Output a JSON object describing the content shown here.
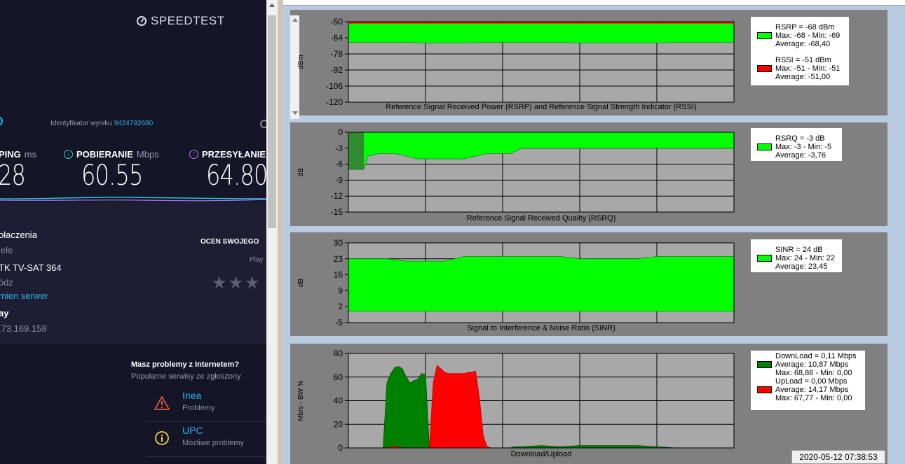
{
  "speedtest": {
    "logo": "SPEEDTEST",
    "result_id_label": "Identyfikator wyniku",
    "result_id": "9424792680",
    "ping": {
      "label": "PING",
      "unit": "ms",
      "value": "28"
    },
    "download": {
      "label": "POBIERANIE",
      "unit": "Mbps",
      "value": "60.55"
    },
    "upload": {
      "label": "PRZESYŁANIE",
      "value": "64.80"
    },
    "connection_label": "ołaczenia",
    "connection_type": "iele",
    "provider": "TK TV-SAT 364",
    "server_city": "ódz",
    "change_server": "mien serwer",
    "ip_label": "ay",
    "ip": ".73.169.158",
    "rate_label": "OCEN SWOJEGO",
    "rate_sub": "Play",
    "problems_title": "Masz problemy z Internetem?",
    "problems_sub": "Popularne serwisy ze zgłoszony",
    "isps": [
      {
        "name": "Inea",
        "status": "Problemy",
        "icon": "warning-triangle-icon",
        "color": "#e8553e"
      },
      {
        "name": "UPC",
        "status": "Mozliwe problemy",
        "icon": "info-circle-icon",
        "color": "#f2d43a"
      }
    ]
  },
  "monitor": {
    "timestamp": "2020-05-12 07:38:53",
    "colors": {
      "green": "#00ff00",
      "dark_green": "#008000",
      "red": "#ff0000",
      "plot_bg": "#a8a8a8",
      "panel_bg": "#808080"
    },
    "charts": [
      {
        "id": "rsrp",
        "type": "area",
        "title": "Reference Signal Received Power (RSRP) and Reference Signal Strength Indicator (RSSI)",
        "ylabel": "dBm",
        "ylim": [
          -120,
          -50
        ],
        "yticks": [
          "-50",
          "-64",
          "-78",
          "-92",
          "-106",
          "-120"
        ],
        "legend": [
          {
            "color": "#00ff00",
            "lines": [
              "RSRP = -68 dBm",
              "Max: -68 - Min: -69",
              "Average: -68,40"
            ]
          },
          {
            "color": "#ff0000",
            "lines": [
              "RSSI = -51 dBm",
              "Max: -51 - Min: -51",
              "Average: -51,00"
            ]
          }
        ]
      },
      {
        "id": "rsrq",
        "type": "area",
        "title": "Reference Signal Received Quality (RSRQ)",
        "ylabel": "dB",
        "ylim": [
          -15,
          0
        ],
        "yticks": [
          "0",
          "-3",
          "-6",
          "-9",
          "-12",
          "-15"
        ],
        "legend": [
          {
            "color": "#00ff00",
            "lines": [
              "RSRQ = -3 dB",
              "Max: -3 - Min: -5",
              "Average: -3,76"
            ]
          }
        ]
      },
      {
        "id": "sinr",
        "type": "area",
        "title": "Signal to Interference & Noise Ratio (SINR)",
        "ylabel": "dB",
        "ylim": [
          -5,
          30
        ],
        "yticks": [
          "30",
          "23",
          "16",
          "9",
          "2",
          "-5"
        ],
        "legend": [
          {
            "color": "#00ff00",
            "lines": [
              "SINR = 24 dB",
              "Max: 24 - Min: 22",
              "Average: 23,45"
            ]
          }
        ]
      },
      {
        "id": "throughput",
        "type": "area",
        "title": "Download/Upload",
        "ylabel": "Mb/s - BW %",
        "ylim": [
          0,
          80
        ],
        "yticks": [
          "80",
          "60",
          "40",
          "20",
          "0"
        ],
        "legend": [
          {
            "color": "#008000",
            "lines": [
              "DownLoad = 0,11 Mbps",
              "Average: 10,87 Mbps",
              "Max: 68,86 - Min: 0,00"
            ]
          },
          {
            "color": "#ff0000",
            "lines": [
              "UpLoad = 0,00 Mbps",
              "Average: 14,17 Mbps",
              "Max: 67,77 - Min: 0,00"
            ]
          }
        ]
      }
    ]
  },
  "chart_data": [
    {
      "type": "area",
      "title": "Reference Signal Received Power (RSRP) and Reference Signal Strength Indicator (RSSI)",
      "ylabel": "dBm",
      "ylim": [
        -120,
        -50
      ],
      "x": [
        0,
        5,
        10,
        15,
        20,
        25,
        30,
        35,
        40,
        45,
        50,
        55,
        60,
        65,
        70,
        75,
        80,
        85,
        90,
        95,
        100
      ],
      "series": [
        {
          "name": "RSRP",
          "values": [
            -68,
            -68,
            -68,
            -68,
            -68.5,
            -68.5,
            -68.5,
            -68,
            -68,
            -68,
            -68,
            -68,
            -68.5,
            -68.5,
            -68.5,
            -68.5,
            -68.5,
            -68,
            -68,
            -68,
            -68
          ]
        },
        {
          "name": "RSSI",
          "values": [
            -51,
            -51,
            -51,
            -51,
            -51,
            -51,
            -51,
            -51,
            -51,
            -51,
            -51,
            -51,
            -51,
            -51,
            -51,
            -51,
            -51,
            -51,
            -51,
            -51,
            -51
          ]
        }
      ]
    },
    {
      "type": "area",
      "title": "Reference Signal Received Quality (RSRQ)",
      "ylabel": "dB",
      "ylim": [
        -15,
        0
      ],
      "x": [
        0,
        4,
        5,
        8,
        12,
        18,
        24,
        30,
        36,
        42,
        45,
        50,
        60,
        70,
        80,
        90,
        100
      ],
      "series": [
        {
          "name": "RSRQ",
          "values": [
            -7,
            -7,
            -4.5,
            -4,
            -4,
            -5,
            -5,
            -5,
            -4,
            -4,
            -3,
            -3,
            -3,
            -3,
            -3,
            -3,
            -3
          ]
        }
      ]
    },
    {
      "type": "area",
      "title": "Signal to Interference & Noise Ratio (SINR)",
      "ylabel": "dB",
      "ylim": [
        -5,
        30
      ],
      "x": [
        0,
        5,
        10,
        15,
        20,
        25,
        30,
        35,
        40,
        45,
        50,
        55,
        60,
        65,
        70,
        75,
        80,
        85,
        90,
        95,
        100
      ],
      "series": [
        {
          "name": "SINR",
          "values": [
            23,
            23,
            23,
            22,
            22,
            22,
            24,
            24,
            24,
            24,
            24,
            24,
            23,
            23,
            23,
            23,
            24,
            24,
            24,
            24,
            24
          ]
        }
      ]
    },
    {
      "type": "area",
      "title": "Download/Upload",
      "ylabel": "Mb/s - BW %",
      "ylim": [
        0,
        80
      ],
      "x": [
        0,
        9,
        10,
        11,
        12,
        13,
        14,
        15,
        16,
        17,
        18,
        19,
        20,
        21,
        22,
        23,
        24,
        25,
        26,
        27,
        28,
        29,
        30,
        31,
        32,
        33,
        34,
        35,
        36,
        37,
        38,
        39,
        40,
        41,
        42,
        43,
        45,
        50,
        55,
        60,
        65,
        70,
        75,
        80,
        85,
        90,
        95,
        100
      ],
      "series": [
        {
          "name": "DownLoad",
          "values": [
            0,
            0,
            55,
            63,
            68,
            69,
            67,
            60,
            55,
            57,
            58,
            63,
            62,
            0,
            0,
            0,
            0,
            0,
            0,
            0,
            0,
            0,
            0,
            0,
            0,
            0,
            0,
            0,
            0,
            0,
            0,
            0,
            0,
            0,
            0,
            1,
            1,
            2,
            1,
            2,
            2,
            2,
            2,
            1,
            0,
            0,
            0,
            0
          ]
        },
        {
          "name": "UpLoad",
          "values": [
            0,
            0,
            0,
            1,
            1,
            1,
            0,
            0,
            0,
            0,
            0,
            0,
            0,
            0,
            55,
            70,
            67,
            64,
            63,
            63,
            63,
            63,
            63,
            64,
            64,
            65,
            42,
            10,
            1,
            0,
            0,
            0,
            0,
            0,
            0,
            0,
            0,
            0,
            0,
            0,
            0,
            0,
            0,
            0,
            0,
            0,
            0,
            0
          ]
        }
      ]
    }
  ]
}
